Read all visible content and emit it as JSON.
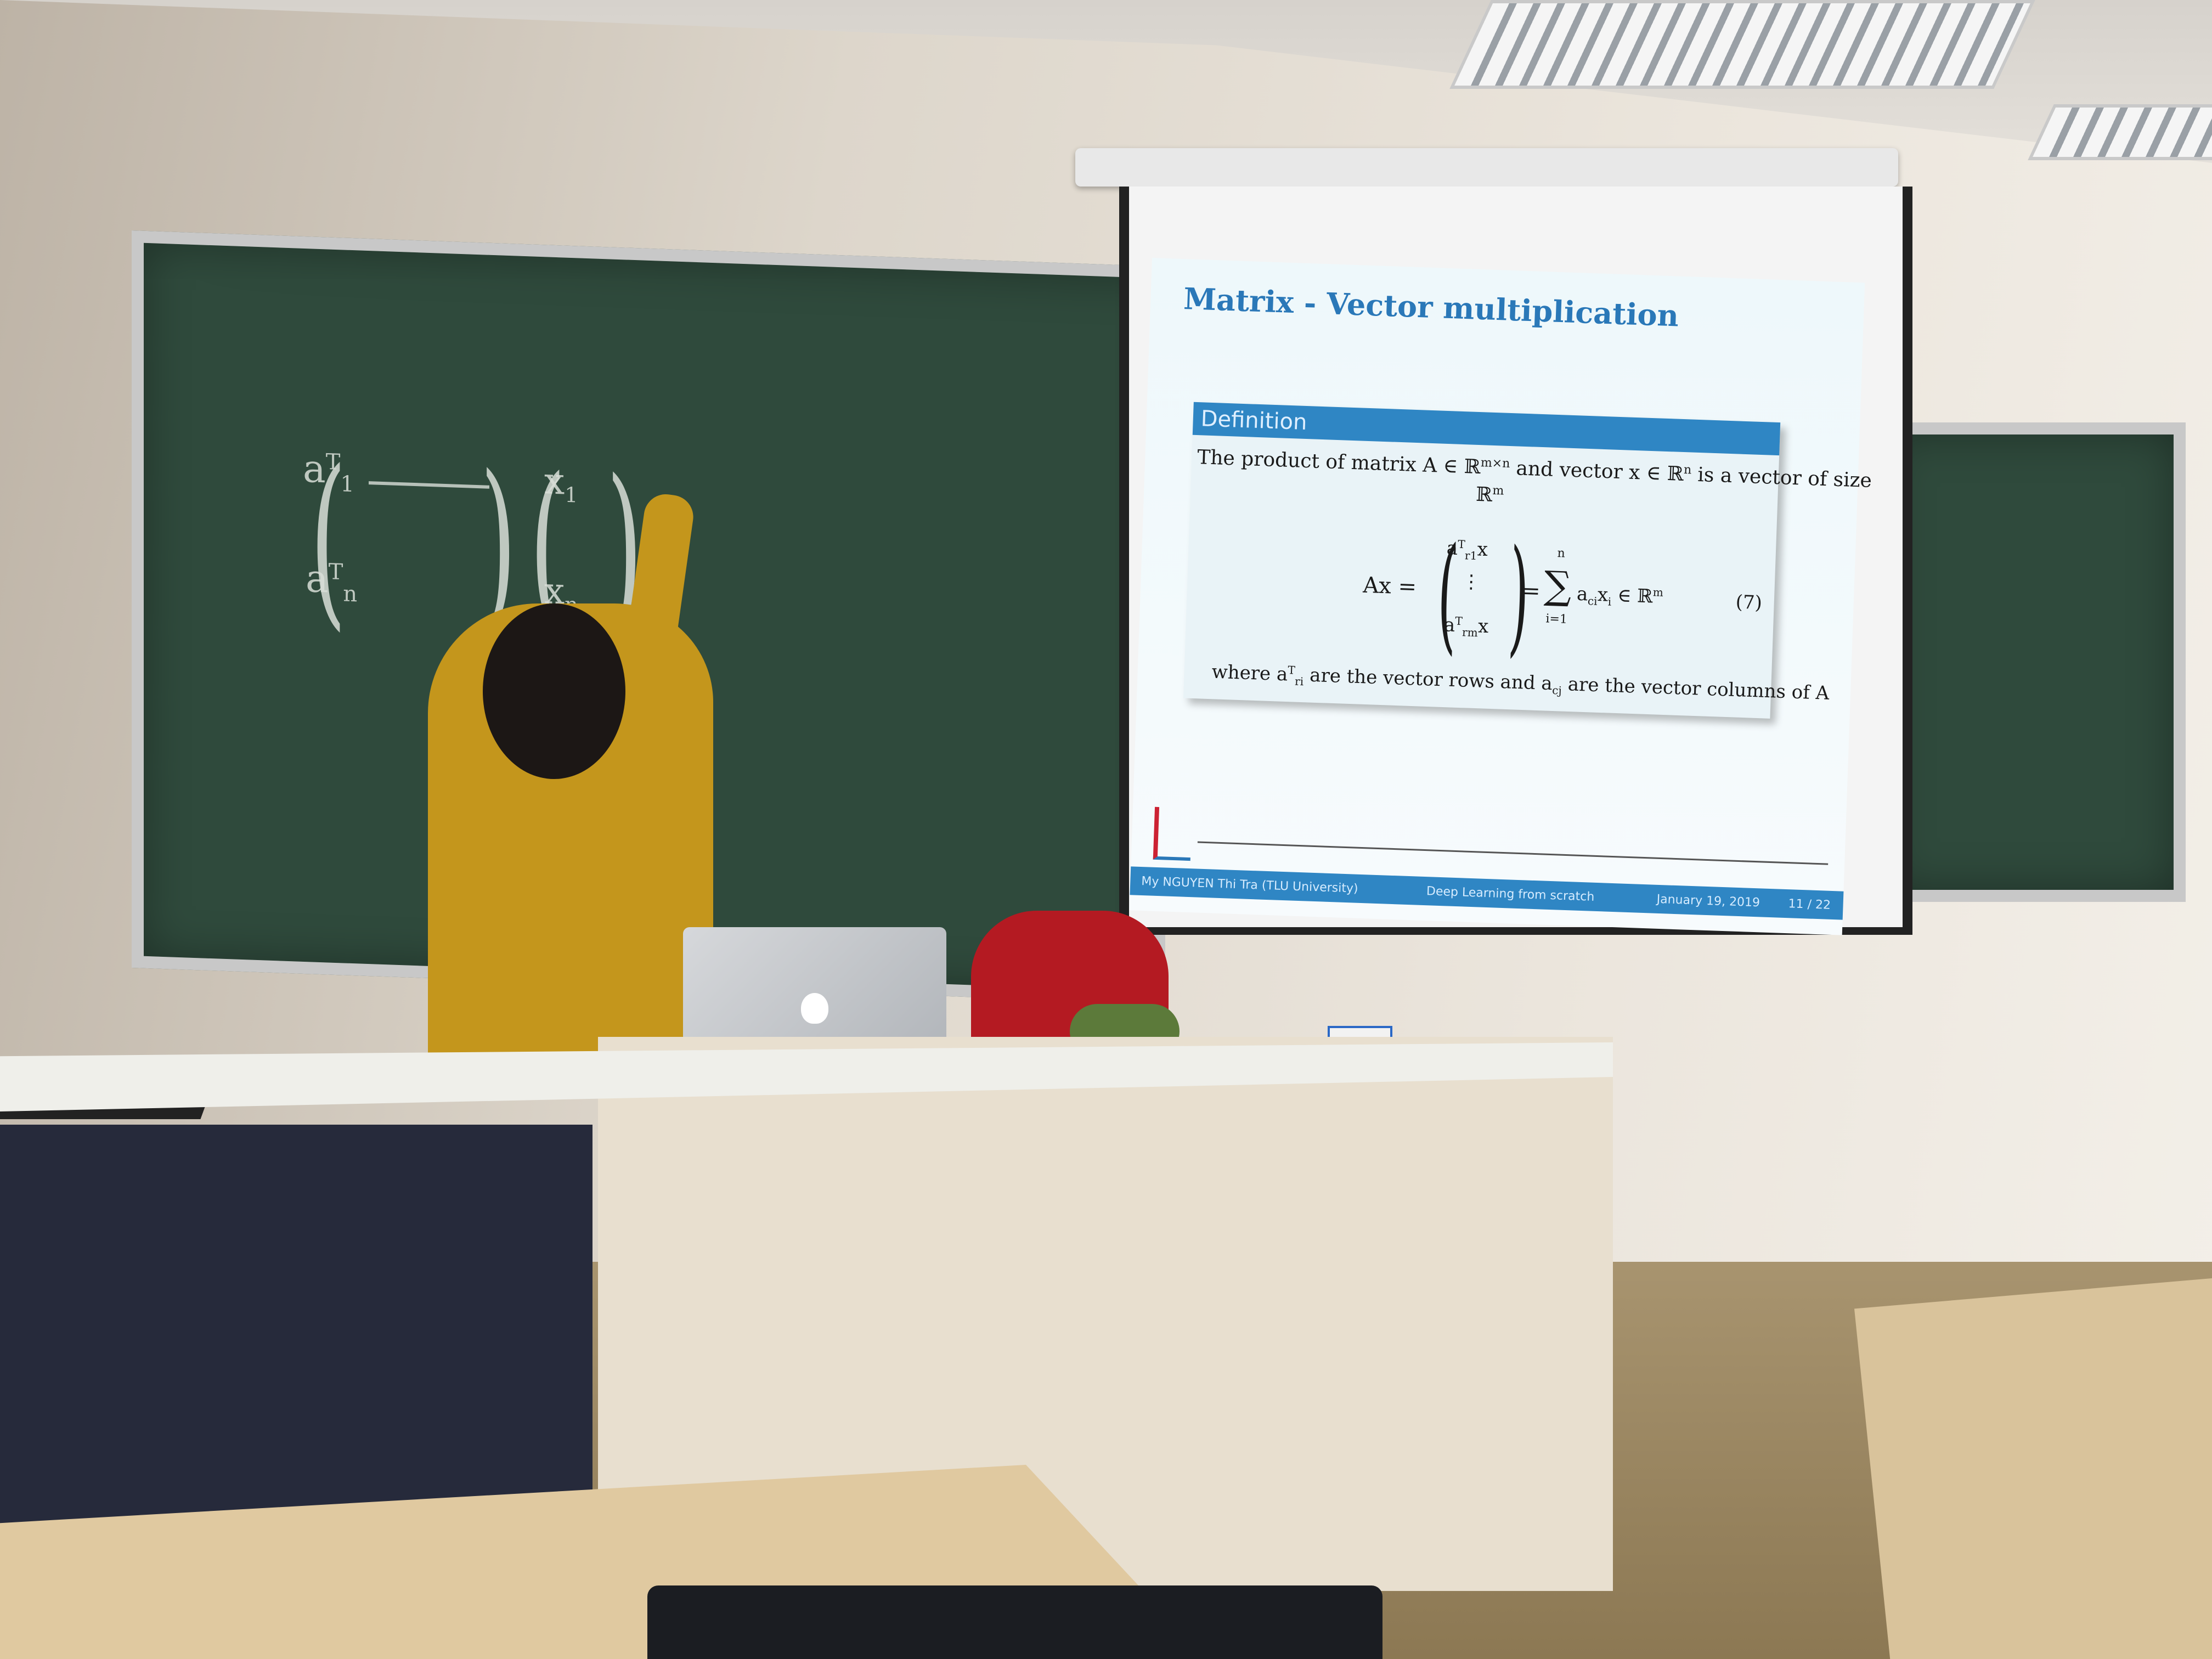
{
  "slide": {
    "title": "Matrix - Vector multiplication",
    "definition_header": "Definition",
    "definition_line1": "The product of matrix A ∈ ℝ",
    "definition_line1_sup": "m×n",
    "definition_line1b": " and vector x ∈ ℝ",
    "definition_line1b_sup": "n",
    "definition_line1c": " is a vector of size",
    "definition_line2": "ℝ",
    "definition_line2_sup": "m",
    "equation_lhs": "Ax =",
    "vector_top": "a",
    "vector_top_sub": "r1",
    "vector_top_sup": "T",
    "vector_top_x": "x",
    "vector_dots": "⋮",
    "vector_bottom": "a",
    "vector_bottom_sub": "rm",
    "vector_bottom_sup": "T",
    "vector_bottom_x": "x",
    "sum_top": "n",
    "sum_symbol": "∑",
    "sum_bottom": "i=1",
    "equation_rhs": "= ",
    "equation_rhs_term": "a",
    "equation_rhs_term_sub": "ci",
    "equation_rhs_tail": "x",
    "equation_rhs_tail_sub": "i",
    "equation_rhs_end": " ∈ ℝ",
    "equation_rhs_end_sup": "m",
    "equation_number": "(7)",
    "where_prefix": "where a",
    "where_sup": "T",
    "where_sub": "ri",
    "where_mid": " are the vector rows and a",
    "where_sub2": "cj",
    "where_end": " are the vector columns of A",
    "footer_author": "My NGUYEN Thi Tra (TLU University)",
    "footer_course": "Deep Learning from scratch",
    "footer_date": "January 19, 2019",
    "footer_page": "11 / 22"
  },
  "chalkboard_left": {
    "row1": "a",
    "row1_sup": "T",
    "row1_sub": "1",
    "row2": "a",
    "row2_sup": "T",
    "row2_sub": "n",
    "x_top": "x",
    "x_top_sub": "1",
    "x_bottom": "x",
    "x_bottom_sub": "n"
  },
  "colors": {
    "slide_title": "#2a78b8",
    "slide_bar": "#2f86c4",
    "chalkboard": "#2f4a3c",
    "sweater": "#c4961c",
    "chair": "#b41a22"
  }
}
